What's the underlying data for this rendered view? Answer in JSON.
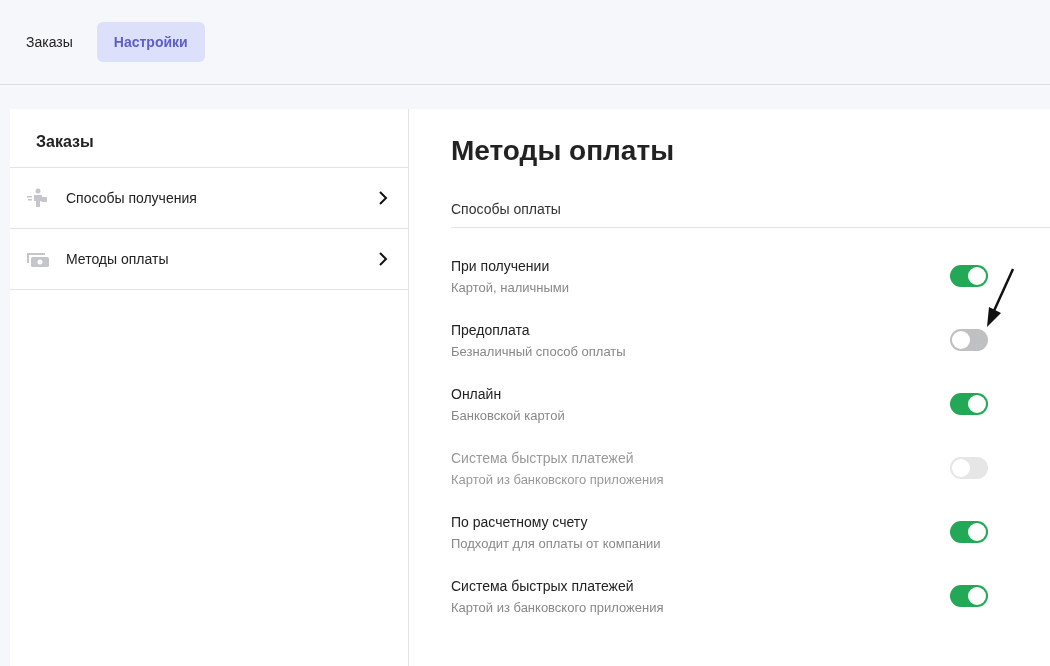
{
  "tabs": [
    {
      "label": "Заказы",
      "selected": false
    },
    {
      "label": "Настройки",
      "selected": true
    }
  ],
  "sidebar": {
    "title": "Заказы",
    "items": [
      {
        "label": "Способы получения",
        "kind": "courier"
      },
      {
        "label": "Методы оплаты",
        "kind": "cash"
      }
    ]
  },
  "main": {
    "title": "Методы оплаты",
    "section": "Способы оплаты",
    "methods": [
      {
        "name": "При получении",
        "description": "Картой, наличными",
        "on": true,
        "disabled": false
      },
      {
        "name": "Предоплата",
        "description": "Безналичный способ оплаты",
        "on": false,
        "disabled": false
      },
      {
        "name": "Онлайн",
        "description": "Банковской картой",
        "on": true,
        "disabled": false
      },
      {
        "name": "Система быстрых платежей",
        "description": "Картой из банковского приложения",
        "on": false,
        "disabled": true
      },
      {
        "name": "По расчетному счету",
        "description": "Подходит для оплаты от компании",
        "on": true,
        "disabled": false
      },
      {
        "name": "Система быстрых платежей",
        "description": "Картой из банковского приложения",
        "on": true,
        "disabled": false
      }
    ]
  }
}
